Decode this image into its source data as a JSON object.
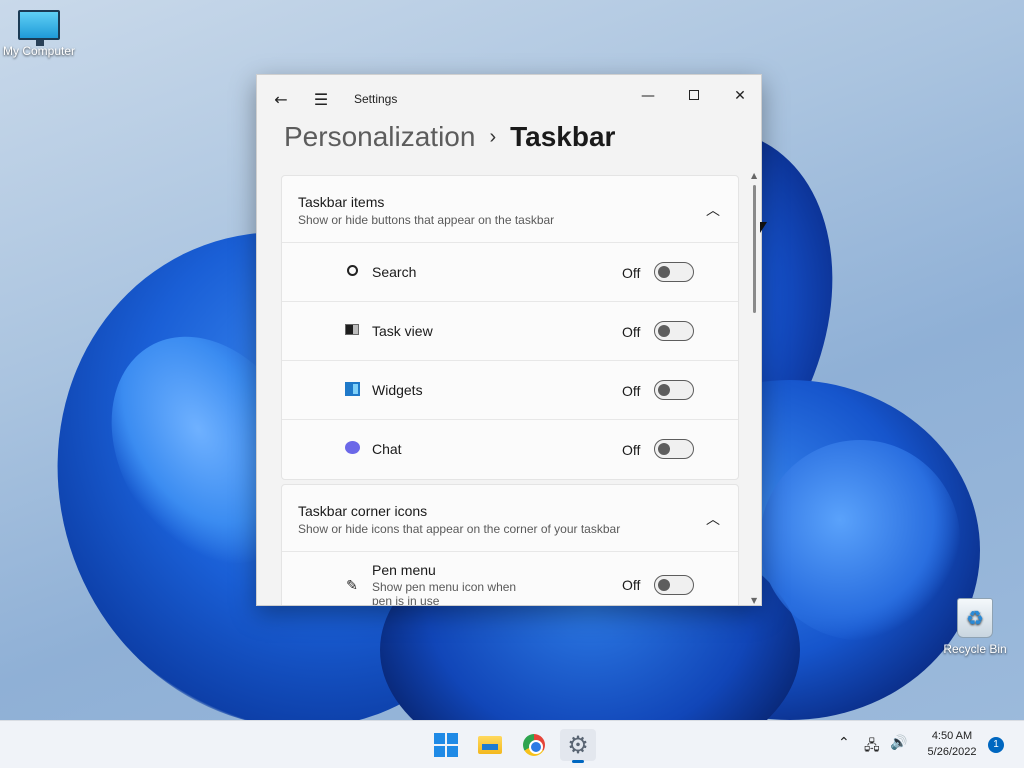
{
  "desktop": {
    "icons": [
      {
        "label": "My Computer",
        "icon": "monitor-icon"
      },
      {
        "label": "Recycle Bin",
        "icon": "recycle-bin-icon"
      }
    ]
  },
  "window": {
    "title": "Settings",
    "breadcrumb": {
      "parent": "Personalization",
      "separator": "›",
      "current": "Taskbar"
    }
  },
  "sections": [
    {
      "title": "Taskbar items",
      "subtitle": "Show or hide buttons that appear on the taskbar",
      "items": [
        {
          "label": "Search",
          "state": "Off",
          "icon": "search-icon"
        },
        {
          "label": "Task view",
          "state": "Off",
          "icon": "task-view-icon"
        },
        {
          "label": "Widgets",
          "state": "Off",
          "icon": "widgets-icon"
        },
        {
          "label": "Chat",
          "state": "Off",
          "icon": "chat-icon"
        }
      ]
    },
    {
      "title": "Taskbar corner icons",
      "subtitle": "Show or hide icons that appear on the corner of your taskbar",
      "items": [
        {
          "label": "Pen menu",
          "description": "Show pen menu icon when pen is in use",
          "state": "Off",
          "icon": "pen-icon"
        }
      ]
    }
  ],
  "taskbar": {
    "apps": [
      "start-icon",
      "file-explorer-icon",
      "chrome-icon",
      "settings-icon"
    ],
    "clock": {
      "time": "4:50 AM",
      "date": "5/26/2022"
    },
    "notification_count": "1"
  },
  "colors": {
    "accent": "#0067c0",
    "window_bg": "#f3f3f3",
    "card_bg": "#fbfbfb"
  }
}
